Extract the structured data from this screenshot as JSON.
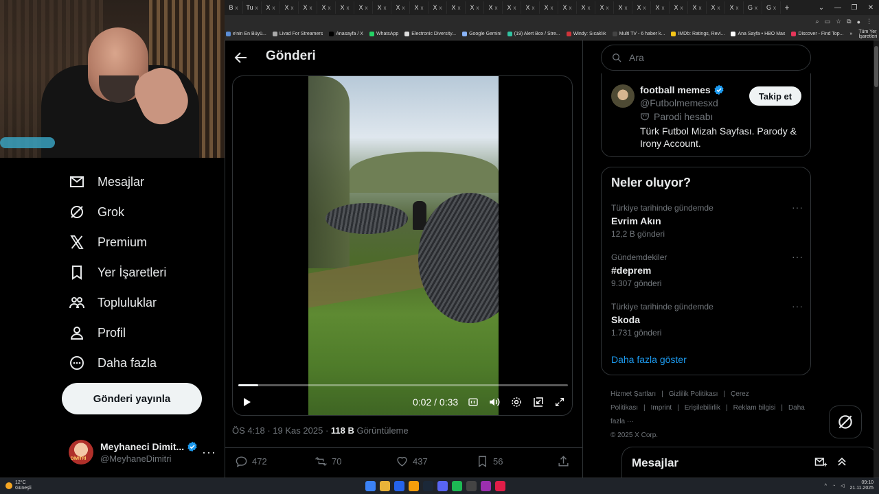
{
  "browser": {
    "tabs": [
      "B",
      "Tu",
      "X",
      "X",
      "X",
      "X",
      "X",
      "X",
      "X",
      "X",
      "X",
      "X",
      "X",
      "X",
      "X",
      "X",
      "X",
      "X",
      "X",
      "X",
      "X",
      "X",
      "X",
      "X",
      "X",
      "X",
      "X",
      "X",
      "G",
      "G"
    ],
    "tab_close": "x",
    "new_tab": "+",
    "bookmarks": [
      {
        "label": "e'nin En Büyü...",
        "color": "#5b8dd6"
      },
      {
        "label": "Livad For Streamers",
        "color": "#aaaaaa"
      },
      {
        "label": "Anasayfa / X",
        "color": "#000000"
      },
      {
        "label": "WhatsApp",
        "color": "#25d366"
      },
      {
        "label": "Electronic Diversity...",
        "color": "#dddddd"
      },
      {
        "label": "Google Gemini",
        "color": "#8ab4f8"
      },
      {
        "label": "(19) Alert Box / Stre...",
        "color": "#31c3a2"
      },
      {
        "label": "Windy: Sıcaklık",
        "color": "#d0343a"
      },
      {
        "label": "Multi TV - 6 haber k...",
        "color": "#444444"
      },
      {
        "label": "IMDb: Ratings, Revi...",
        "color": "#f5c518"
      },
      {
        "label": "Ana Sayfa • HBO Max",
        "color": "#ffffff"
      },
      {
        "label": "Discover - Find Top...",
        "color": "#e5365a"
      }
    ],
    "bookmarks_more": "»",
    "all_bookmarks": "Tüm Yer İşaretleri"
  },
  "leftnav": {
    "items": [
      {
        "label": "Mesajlar",
        "icon": "envelope-icon"
      },
      {
        "label": "Grok",
        "icon": "grok-icon"
      },
      {
        "label": "Premium",
        "icon": "x-logo-icon"
      },
      {
        "label": "Yer İşaretleri",
        "icon": "bookmark-icon"
      },
      {
        "label": "Topluluklar",
        "icon": "communities-icon"
      },
      {
        "label": "Profil",
        "icon": "person-icon"
      },
      {
        "label": "Daha fazla",
        "icon": "more-circle-icon"
      }
    ],
    "post_button": "Gönderi yayınla",
    "account": {
      "name": "Meyhaneci Dimit...",
      "handle": "@MeyhaneDimitri",
      "avatar_tag": "DİMİTRİ",
      "more": "···"
    }
  },
  "main": {
    "title": "Gönderi",
    "video": {
      "current_time": "0:02",
      "separator": "/",
      "duration": "0:33",
      "progress": 0.06
    },
    "meta": {
      "time": "ÖS 4:18",
      "dot": "·",
      "date": "19 Kas 2025",
      "views_count": "118 B",
      "views_label": "Görüntüleme"
    },
    "actions": {
      "replies": "472",
      "reposts": "70",
      "likes": "437",
      "bookmarks": "56"
    }
  },
  "right": {
    "search_placeholder": "Ara",
    "profile": {
      "name": "football memes",
      "handle": "@Futbolmemesxd",
      "badge": "Parodi hesabı",
      "bio": "Türk Futbol Mizah Sayfası. Parody & Irony Account.",
      "follow": "Takip et"
    },
    "trends": {
      "title": "Neler oluyor?",
      "items": [
        {
          "context": "Türkiye tarihinde gündemde",
          "name": "Evrim Akın",
          "count": "12,2 B gönderi"
        },
        {
          "context": "Gündemdekiler",
          "name": "#deprem",
          "count": "9.307 gönderi"
        },
        {
          "context": "Türkiye tarihinde gündemde",
          "name": "Skoda",
          "count": "1.731 gönderi"
        }
      ],
      "more_dots": "···",
      "show_more": "Daha fazla göster"
    },
    "footer": {
      "links": [
        "Hizmet Şartları",
        "|",
        "Gizlilik Politikası",
        "|",
        "Çerez Politikası",
        "|",
        "Imprint",
        "|",
        "Erişilebilirlik",
        "|",
        "Reklam bilgisi",
        "|",
        "Daha fazla ···"
      ],
      "copyright": "© 2025 X Corp."
    },
    "messages_drawer": "Mesajlar"
  },
  "taskbar": {
    "weather_temp": "12°C",
    "weather_desc": "Güneşli",
    "time": "09:10",
    "date": "21.11.2025"
  },
  "colors": {
    "accent": "#1d9bf0",
    "verified": "#1d9bf0",
    "border": "#2f3336",
    "muted": "#71767b"
  }
}
